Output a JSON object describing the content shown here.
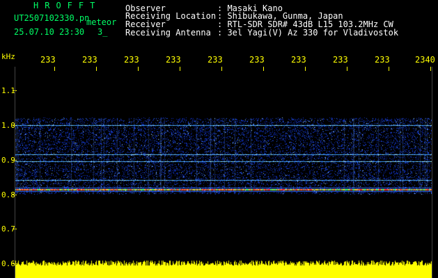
{
  "header": {
    "app_name": "HROFFT",
    "file_name": "UT2507102330.pn",
    "mode": "meteor",
    "date_time": "25.07.10 23:30",
    "slot": "3_",
    "info": [
      {
        "label": "Observer",
        "value": ": Masaki Kano"
      },
      {
        "label": "Receiving Location",
        "value": ": Shibukawa, Gunma, Japan"
      },
      {
        "label": "Receiver",
        "value": ": RTL-SDR SDR# 43dB L15 103.2MHz CW"
      },
      {
        "label": "Receiving Antenna",
        "value": ": 3el Yagi(V) Az 330 for Vladivostok"
      }
    ]
  },
  "axes": {
    "y_unit": "kHz",
    "y_ticks": [
      "1.1",
      "1.0",
      "0.9",
      "0.8",
      "0.7",
      "0.6"
    ],
    "x_ticks": [
      "233",
      "233",
      "233",
      "233",
      "233",
      "233",
      "233",
      "233",
      "233",
      "2340"
    ]
  },
  "spectrogram": {
    "band_top_khz": 1.02,
    "band_bottom_khz": 0.8,
    "strong_line_khz": 0.815,
    "lines_khz": [
      1.0,
      0.915,
      0.895,
      0.84,
      0.815
    ],
    "colors": {
      "background": "#000000",
      "axis": "#ffff00",
      "header_green": "#00ff66",
      "noise": "#1a3cff",
      "hot": "#ff3040"
    }
  }
}
